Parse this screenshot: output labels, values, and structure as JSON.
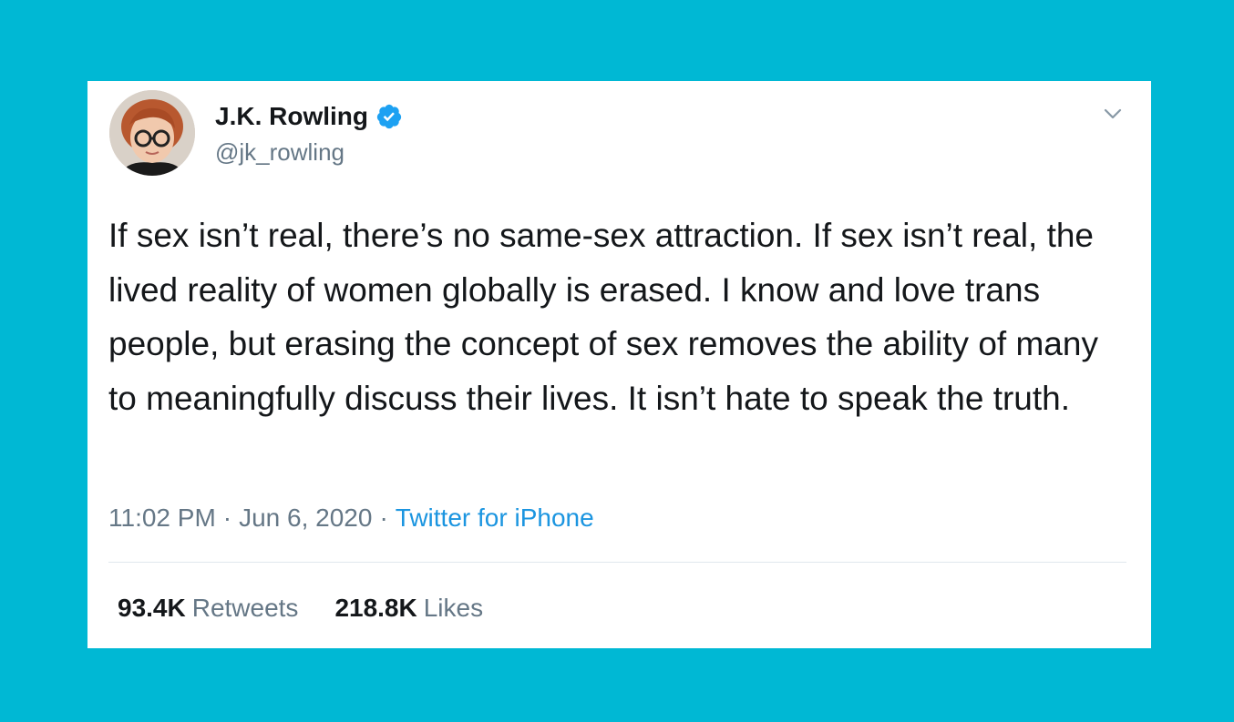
{
  "colors": {
    "background": "#00b8d4",
    "card": "#ffffff",
    "text_primary": "#14171a",
    "text_secondary": "#657786",
    "link": "#1b95e0",
    "verified_badge": "#1da1f2"
  },
  "author": {
    "display_name": "J.K. Rowling",
    "handle": "@jk_rowling",
    "verified": true,
    "avatar_icon": "profile-photo",
    "badge_icon": "verified-badge-icon"
  },
  "menu_icon": "chevron-down-icon",
  "tweet": {
    "text": "If sex isn’t real, there’s no same-sex attraction. If sex isn’t real, the lived reality of women globally is erased. I know and love trans people, but erasing the concept of sex removes the ability of many to meaningfully discuss their lives. It isn’t hate to speak the truth.",
    "time": "11:02 PM",
    "separator": "·",
    "date": "Jun 6, 2020",
    "source": "Twitter for iPhone"
  },
  "stats": {
    "retweets_count": "93.4K",
    "retweets_label": "Retweets",
    "likes_count": "218.8K",
    "likes_label": "Likes"
  }
}
